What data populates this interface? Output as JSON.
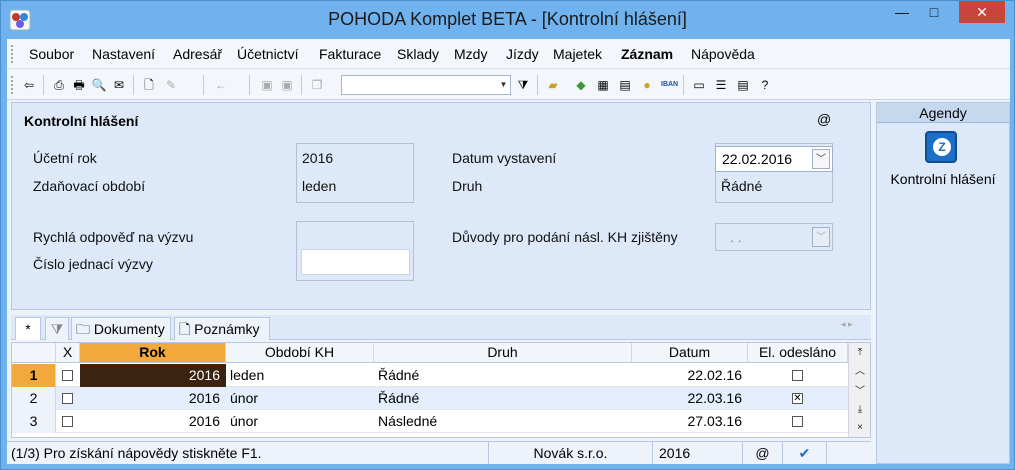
{
  "window": {
    "title": "POHODA Komplet BETA - [Kontrolní hlášení]",
    "minimize": "—",
    "maximize": "□",
    "close": "✕"
  },
  "menu": [
    "Soubor",
    "Nastavení",
    "Adresář",
    "Účetnictví",
    "Fakturace",
    "Sklady",
    "Mzdy",
    "Jízdy",
    "Majetek",
    "Záznam",
    "Nápověda"
  ],
  "toolbar": {
    "combo_value": ""
  },
  "form": {
    "title": "Kontrolní hlášení",
    "at": "@",
    "fields": {
      "ucetni_rok_label": "Účetní rok",
      "ucetni_rok_value": "2016",
      "zdanovaci_label": "Zdaňovací období",
      "zdanovaci_value": "leden",
      "datum_vystaveni_label": "Datum vystavení",
      "datum_vystaveni_value": "22.02.2016",
      "druh_label": "Druh",
      "druh_value": "Řádné",
      "rychla_label": "Rychlá odpověď na výzvu",
      "cislo_label": "Číslo jednací výzvy",
      "duvody_label": "Důvody pro podání násl. KH zjištěny",
      "duvody_value": ". ."
    }
  },
  "agendy": {
    "header": "Agendy",
    "item": "Kontrolní hlášení"
  },
  "tabs": {
    "star": "*",
    "dokumenty": "Dokumenty",
    "poznamky": "Poznámky"
  },
  "grid": {
    "headers": [
      "X",
      "Rok",
      "Období KH",
      "Druh",
      "Datum",
      "El. odesláno"
    ],
    "rows": [
      {
        "num": "1",
        "rok": "2016",
        "obdobi": "leden",
        "druh": "Řádné",
        "datum": "22.02.16",
        "odeslano": false
      },
      {
        "num": "2",
        "rok": "2016",
        "obdobi": "únor",
        "druh": "Řádné",
        "datum": "22.03.16",
        "odeslano": true
      },
      {
        "num": "3",
        "rok": "2016",
        "obdobi": "únor",
        "druh": "Následné",
        "datum": "27.03.16",
        "odeslano": false
      }
    ]
  },
  "status": {
    "help": "(1/3) Pro získání nápovědy stiskněte F1.",
    "company": "Novák s.r.o.",
    "year": "2016",
    "at": "@"
  }
}
